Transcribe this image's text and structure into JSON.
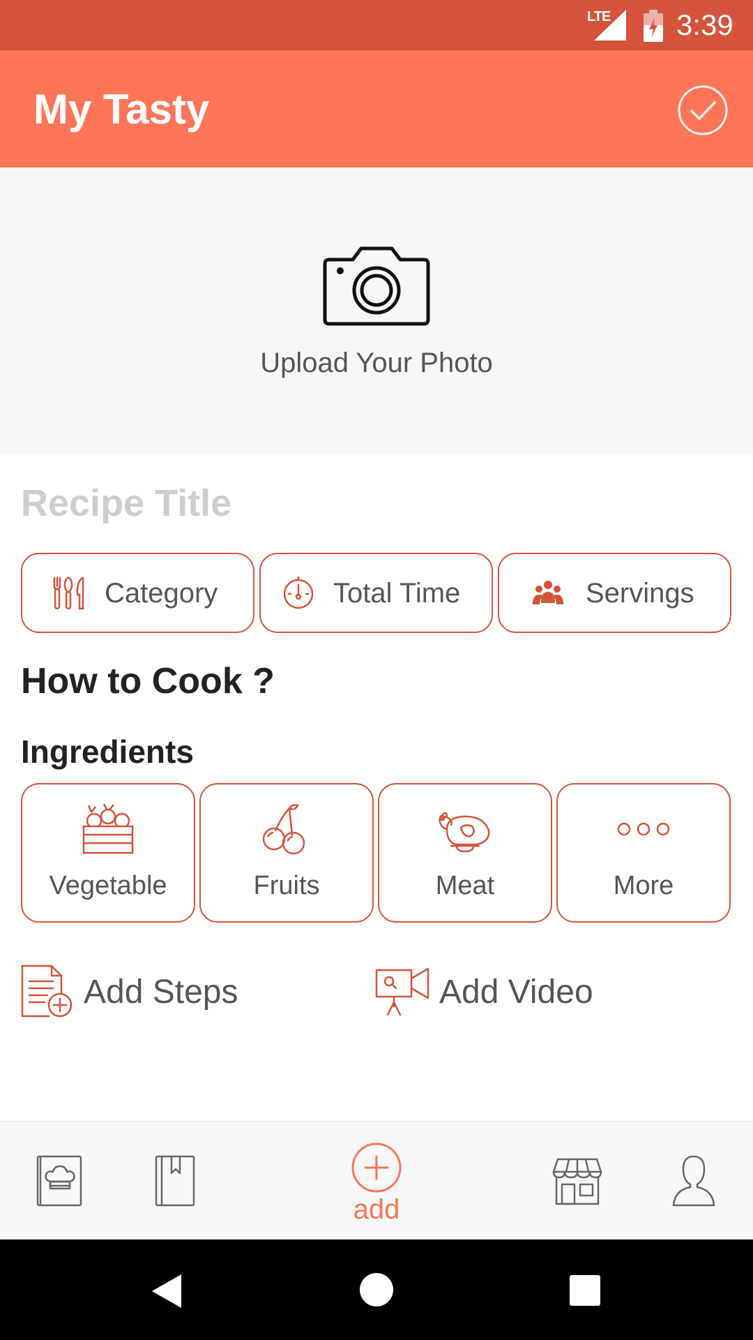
{
  "status_bar": {
    "network": "LTE",
    "time": "3:39"
  },
  "app_bar": {
    "title": "My Tasty",
    "confirm_icon": "check-circle-icon"
  },
  "photo_upload": {
    "icon": "camera-icon",
    "label": "Upload Your Photo"
  },
  "recipe": {
    "title_placeholder": "Recipe Title"
  },
  "meta_buttons": [
    {
      "label": "Category",
      "icon": "utensils-icon"
    },
    {
      "label": "Total Time",
      "icon": "timer-icon"
    },
    {
      "label": "Servings",
      "icon": "people-icon"
    }
  ],
  "how_to_cook": {
    "heading": "How to Cook ?"
  },
  "ingredients": {
    "heading": "Ingredients",
    "items": [
      {
        "label": "Vegetable",
        "icon": "vegetable-basket-icon"
      },
      {
        "label": "Fruits",
        "icon": "cherries-icon"
      },
      {
        "label": "Meat",
        "icon": "chicken-icon"
      },
      {
        "label": "More",
        "icon": "more-dots-icon"
      }
    ]
  },
  "actions": {
    "add_steps": {
      "label": "Add Steps",
      "icon": "add-document-icon"
    },
    "add_video": {
      "label": "Add Video",
      "icon": "video-camera-icon"
    }
  },
  "bottom_nav": {
    "items": [
      {
        "icon": "chef-book-icon"
      },
      {
        "icon": "bookmark-book-icon"
      },
      {
        "icon": "add-circle-icon",
        "label": "add"
      },
      {
        "icon": "store-icon"
      },
      {
        "icon": "user-icon"
      }
    ]
  },
  "colors": {
    "accent": "#ff7558",
    "status_bar": "#d5533a",
    "outline": "#d5533a"
  }
}
